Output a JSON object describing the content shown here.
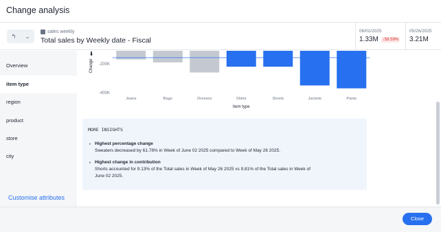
{
  "dialog": {
    "title": "Change analysis"
  },
  "context": {
    "source": "sales weekly",
    "title": "Total sales by Weekly date - Fiscal",
    "metrics": [
      {
        "date": "06/02/2025",
        "value": "1.33M",
        "change": "↓58.59%"
      },
      {
        "date": "05/26/2025",
        "value": "3.21M"
      }
    ]
  },
  "sidebar": {
    "items": [
      {
        "label": "Overview"
      },
      {
        "label": "item type",
        "active": true
      },
      {
        "label": "region"
      },
      {
        "label": "product"
      },
      {
        "label": "store"
      },
      {
        "label": "city"
      }
    ],
    "customise_label": "Customise attributes"
  },
  "chart_data": {
    "type": "bar",
    "categories": [
      "Jeans",
      "Bags",
      "Dresses",
      "Shirts",
      "Shorts",
      "Jackets",
      "Pants"
    ],
    "values": [
      -170000,
      -190000,
      -260000,
      -220000,
      -220000,
      -350000,
      -370000
    ],
    "colors": [
      "#c4c9d1",
      "#c4c9d1",
      "#c4c9d1",
      "#2770ef",
      "#2770ef",
      "#2770ef",
      "#2770ef"
    ],
    "xlabel": "Item type",
    "ylabel": "Change",
    "yticks": [
      {
        "value": -200000,
        "label": "-200K"
      },
      {
        "value": -400000,
        "label": "-400K"
      }
    ]
  },
  "insights": {
    "heading": "MORE INSIGHTS",
    "items": [
      {
        "title": "Highest percentage change",
        "body": "Sweaters decreased by 61.78% in Week of June 02 2025 compared to Week of May 26 2025."
      },
      {
        "title": "Highest change in contribution",
        "body": "Shorts accounted for 9.13% of the Total sales in Week of May 26 2025 vs 9.81% of the Total sales in Week of June 02 2025."
      }
    ]
  },
  "footer": {
    "close_label": "Close"
  },
  "colors": {
    "accent": "#2770ef",
    "negative": "#d3302f",
    "muted_bar": "#c4c9d1"
  }
}
